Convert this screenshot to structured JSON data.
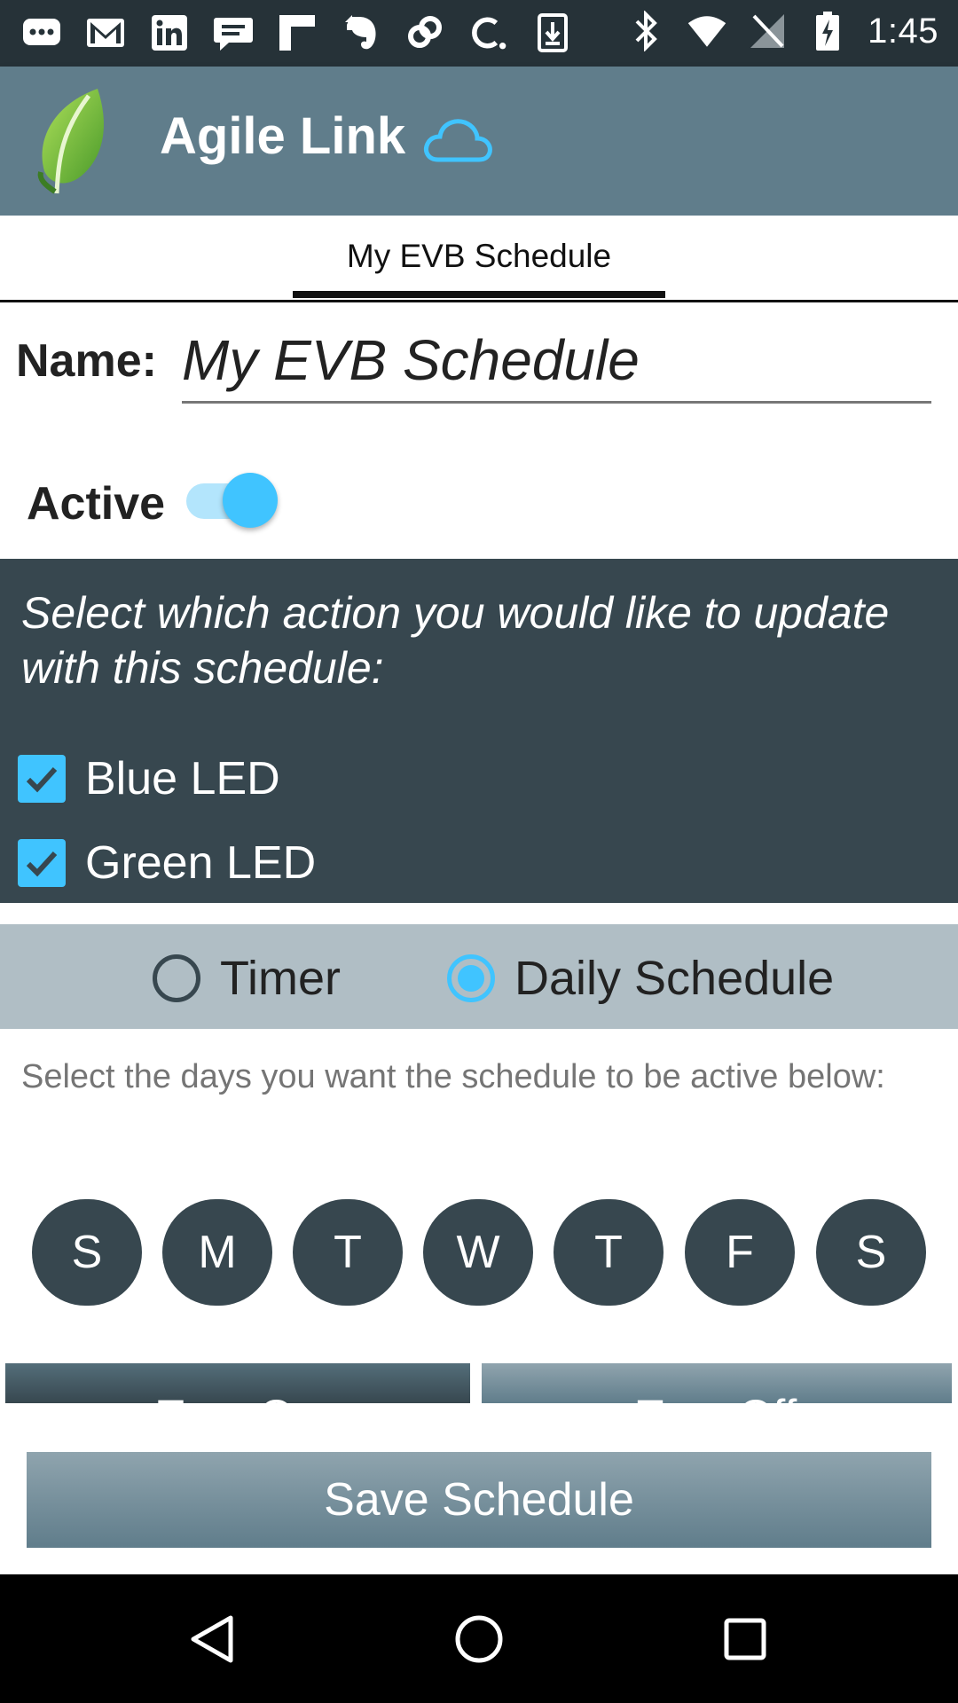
{
  "status_bar": {
    "time": "1:45",
    "left_icons": [
      "chat-bubbles-icon",
      "gmail-icon",
      "linkedin-icon",
      "message-icon",
      "flipboard-icon",
      "evernote-icon",
      "link-icon",
      "c-app-icon",
      "download-icon"
    ],
    "right_icons": [
      "bluetooth-icon",
      "wifi-icon",
      "no-signal-icon",
      "battery-charging-icon"
    ]
  },
  "app_bar": {
    "title": "Agile Link",
    "logo_icon": "leaf-logo-icon",
    "cloud_icon": "cloud-icon",
    "colors": {
      "app_bar": "#607d8b",
      "accent": "#40c4ff"
    }
  },
  "tabs": [
    {
      "label": "My EVB Schedule",
      "selected": true
    }
  ],
  "form": {
    "name_label": "Name:",
    "name_value": "My EVB Schedule",
    "active_label": "Active",
    "active_on": true
  },
  "actions": {
    "prompt": "Select which action you would like to update with this schedule:",
    "items": [
      {
        "label": "Blue LED",
        "checked": true
      },
      {
        "label": "Green LED",
        "checked": true
      }
    ]
  },
  "mode": {
    "options": [
      {
        "label": "Timer",
        "selected": false
      },
      {
        "label": "Daily Schedule",
        "selected": true
      }
    ]
  },
  "days": {
    "hint": "Select the days you want the schedule to be active below:",
    "items": [
      "S",
      "M",
      "T",
      "W",
      "T",
      "F",
      "S"
    ]
  },
  "buttons": {
    "turn_on": "Turn On",
    "turn_off": "Turn Off",
    "save": "Save Schedule"
  },
  "nav_bar": {
    "icons": [
      "back-triangle-icon",
      "home-circle-icon",
      "recents-square-icon"
    ]
  }
}
